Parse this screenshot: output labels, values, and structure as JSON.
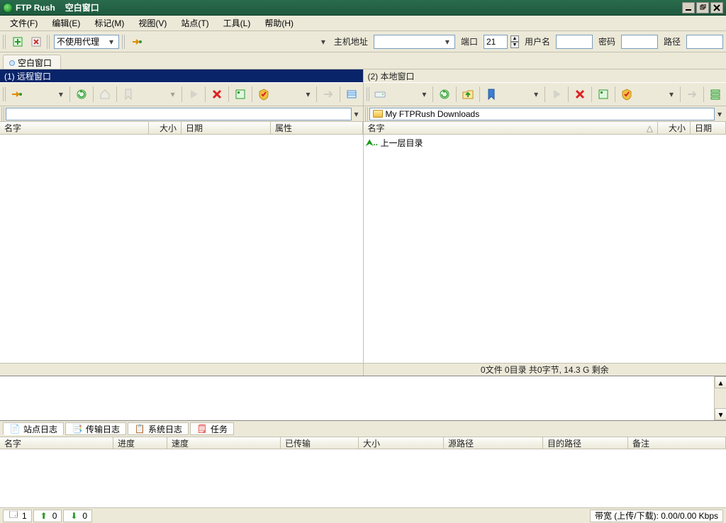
{
  "title": {
    "app": "FTP Rush",
    "doc": "空白窗口"
  },
  "menu": [
    "文件(F)",
    "编辑(E)",
    "标记(M)",
    "视图(V)",
    "站点(T)",
    "工具(L)",
    "帮助(H)"
  ],
  "conn": {
    "proxy_label": "不使用代理",
    "host_label": "主机地址",
    "host_value": "",
    "port_label": "端口",
    "port_value": "21",
    "user_label": "用户名",
    "user_value": "",
    "pass_label": "密码",
    "pass_value": "",
    "path_label": "路径",
    "path_value": ""
  },
  "tab": "空白窗口",
  "remote": {
    "title": "(1) 远程窗口",
    "path": "",
    "cols": [
      "名字",
      "大小",
      "日期",
      "属性"
    ],
    "status": ""
  },
  "local": {
    "title": "(2) 本地窗口",
    "path": "My FTPRush Downloads",
    "cols": [
      "名字",
      "大小",
      "日期"
    ],
    "updir": "上一层目录",
    "status": "0文件 0目录 共0字节, 14.3 G 剩余"
  },
  "bottom_tabs": [
    "站点日志",
    "传输日志",
    "系统日志",
    "任务"
  ],
  "queue_cols": [
    "名字",
    "进度",
    "速度",
    "已传输",
    "大小",
    "源路径",
    "目的路径",
    "备注"
  ],
  "status": {
    "c1": "1",
    "c2": "0",
    "c3": "0",
    "bw": "带宽 (上传/下载): 0.00/0.00 Kbps"
  }
}
